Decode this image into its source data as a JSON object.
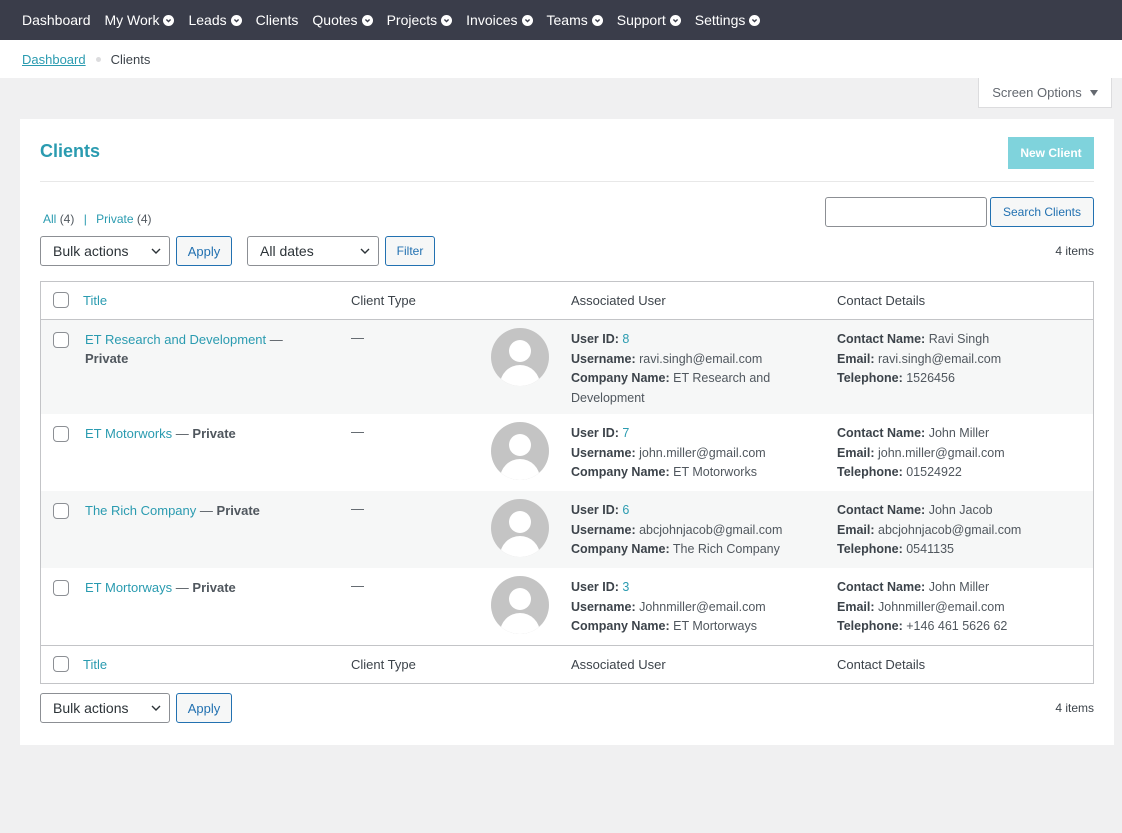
{
  "nav": {
    "items": [
      {
        "label": "Dashboard",
        "caret": false
      },
      {
        "label": "My Work",
        "caret": true
      },
      {
        "label": "Leads",
        "caret": true
      },
      {
        "label": "Clients",
        "caret": false
      },
      {
        "label": "Quotes",
        "caret": true
      },
      {
        "label": "Projects",
        "caret": true
      },
      {
        "label": "Invoices",
        "caret": true
      },
      {
        "label": "Teams",
        "caret": true
      },
      {
        "label": "Support",
        "caret": true
      },
      {
        "label": "Settings",
        "caret": true
      }
    ]
  },
  "breadcrumb": {
    "home": "Dashboard",
    "current": "Clients"
  },
  "screen_options_label": "Screen Options",
  "page": {
    "title": "Clients",
    "new_button": "New Client"
  },
  "views": {
    "all_label": "All",
    "all_count": "(4)",
    "private_label": "Private",
    "private_count": "(4)",
    "separator": "|"
  },
  "search": {
    "value": "",
    "button": "Search Clients"
  },
  "filters": {
    "bulk_actions": "Bulk actions",
    "apply": "Apply",
    "dates": "All dates",
    "filter": "Filter"
  },
  "items_count": "4 items",
  "columns": {
    "title": "Title",
    "client_type": "Client Type",
    "associated_user": "Associated User",
    "contact_details": "Contact Details"
  },
  "labels": {
    "user_id": "User ID:",
    "username": "Username:",
    "company_name": "Company Name:",
    "contact_name": "Contact Name:",
    "email": "Email:",
    "telephone": "Telephone:",
    "dash": "—"
  },
  "rows": [
    {
      "title": "ET Research and Development",
      "status": "Private",
      "client_type": "—",
      "user_id": "8",
      "username": "ravi.singh@email.com",
      "company": "ET Research and Development",
      "contact_name": "Ravi Singh",
      "email": "ravi.singh@email.com",
      "telephone": "1526456"
    },
    {
      "title": "ET Motorworks",
      "status": "Private",
      "client_type": "—",
      "user_id": "7",
      "username": "john.miller@gmail.com",
      "company": "ET Motorworks",
      "contact_name": "John Miller",
      "email": "john.miller@gmail.com",
      "telephone": "01524922"
    },
    {
      "title": "The Rich Company",
      "status": "Private",
      "client_type": "—",
      "user_id": "6",
      "username": "abcjohnjacob@gmail.com",
      "company": "The Rich Company",
      "contact_name": "John Jacob",
      "email": "abcjohnjacob@gmail.com",
      "telephone": "0541135"
    },
    {
      "title": "ET Mortorways",
      "status": "Private",
      "client_type": "—",
      "user_id": "3",
      "username": "Johnmiller@email.com",
      "company": "ET Mortorways",
      "contact_name": "John Miller",
      "email": "Johnmiller@email.com",
      "telephone": "+146 461 5626 62"
    }
  ]
}
